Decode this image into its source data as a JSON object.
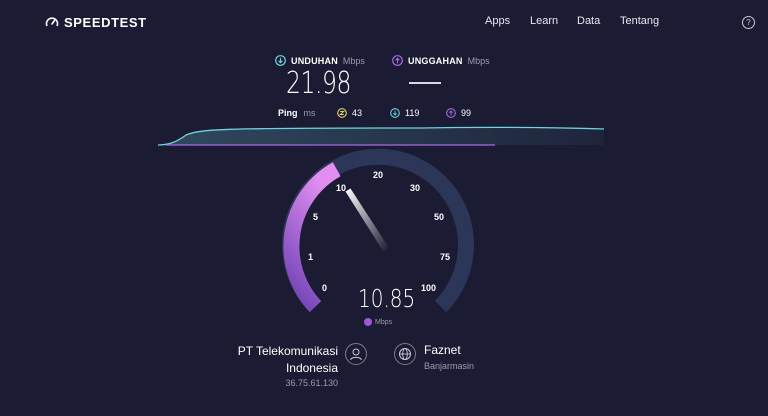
{
  "brand": {
    "name": "SPEEDTEST"
  },
  "nav": {
    "items": [
      "Apps",
      "Learn",
      "Data",
      "Tentang"
    ]
  },
  "download": {
    "label": "UNDUHAN",
    "unit": "Mbps",
    "value": "21.98"
  },
  "upload": {
    "label": "UNGGAHAN",
    "unit": "Mbps",
    "value": ""
  },
  "ping": {
    "label": "Ping",
    "unit": "ms",
    "idle": "43",
    "download": "119",
    "upload": "99"
  },
  "gauge": {
    "ticks": [
      "0",
      "1",
      "5",
      "10",
      "20",
      "30",
      "50",
      "75",
      "100"
    ],
    "current_value": "10.85",
    "unit": "Mbps"
  },
  "isp": {
    "name_line1": "PT Telekomunikasi",
    "name_line2": "Indonesia",
    "ip": "36.75.61.130"
  },
  "server": {
    "name": "Faznet",
    "location": "Banjarmasin"
  },
  "colors": {
    "background": "#1b1b33",
    "download": "#6fd3e0",
    "upload": "#a56ce0",
    "ping": "#e6d36a"
  }
}
